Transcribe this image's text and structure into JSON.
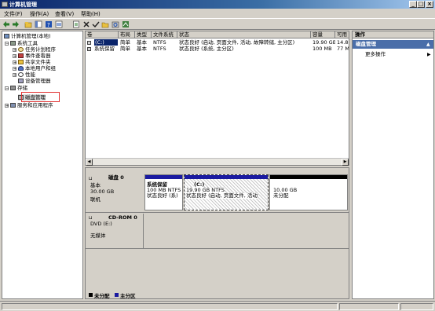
{
  "window": {
    "title": "计算机管理"
  },
  "menu": [
    "文件(F)",
    "操作(A)",
    "查看(V)",
    "帮助(H)"
  ],
  "tree": {
    "root": "计算机管理(本地)",
    "system_tools": "系统工具",
    "task_scheduler": "任务计划程序",
    "event_viewer": "事件查看器",
    "shared_folders": "共享文件夹",
    "local_users": "本地用户和组",
    "performance": "性能",
    "device_manager": "设备管理器",
    "storage": "存储",
    "disk_management": "磁盘管理",
    "services_apps": "服务和应用程序"
  },
  "volumes": {
    "columns": [
      "卷",
      "布局",
      "类型",
      "文件系统",
      "状态",
      "容量",
      "可用"
    ],
    "rows": [
      [
        "(C:)",
        "简单",
        "基本",
        "NTFS",
        "状态良好 (启动, 页面文件, 活动, 故障转储, 主分区)",
        "19.90 GB",
        "14.8"
      ],
      [
        "系统保留",
        "简单",
        "基本",
        "NTFS",
        "状态良好 (系统, 主分区)",
        "100 MB",
        "77 M"
      ]
    ]
  },
  "disk0": {
    "name": "磁盘 0",
    "type": "基本",
    "size": "30.00 GB",
    "status": "联机",
    "partitions": [
      {
        "name": "系统保留",
        "size": "100 MB NTFS",
        "status": "状态良好 (系)"
      },
      {
        "name": "(C:)",
        "size": "19.90 GB NTFS",
        "status": "状态良好 (启动, 页面文件, 活动"
      },
      {
        "name": "",
        "size": "10.00 GB",
        "status": "未分配"
      }
    ]
  },
  "cdrom0": {
    "name": "CD-ROM 0",
    "type": "DVD (E:)",
    "status": "无媒体"
  },
  "legend": {
    "unallocated": "未分配",
    "primary": "主分区"
  },
  "actions": {
    "header": "操作",
    "section": "磁盘管理",
    "more": "更多操作"
  },
  "colors": {
    "primary_partition": "#1a1aa0",
    "unallocated": "#000000",
    "highlight": "#e03030"
  }
}
